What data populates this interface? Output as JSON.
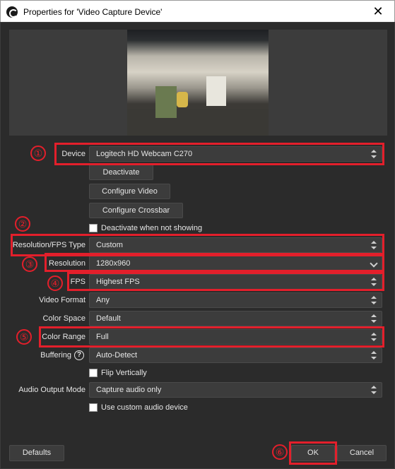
{
  "window": {
    "title": "Properties for 'Video Capture Device'",
    "close_glyph": "✕",
    "app_icon": "obs-icon"
  },
  "form": {
    "device": {
      "label": "Device",
      "value": "Logitech HD Webcam C270"
    },
    "deactivate_label": "Deactivate",
    "configure_video_label": "Configure Video",
    "configure_crossbar_label": "Configure Crossbar",
    "deactivate_when_hidden": {
      "label": "Deactivate when not showing",
      "checked": false
    },
    "res_fps_type": {
      "label": "Resolution/FPS Type",
      "value": "Custom"
    },
    "resolution": {
      "label": "Resolution",
      "value": "1280x960"
    },
    "fps": {
      "label": "FPS",
      "value": "Highest FPS"
    },
    "video_format": {
      "label": "Video Format",
      "value": "Any"
    },
    "color_space": {
      "label": "Color Space",
      "value": "Default"
    },
    "color_range": {
      "label": "Color Range",
      "value": "Full"
    },
    "buffering": {
      "label": "Buffering",
      "value": "Auto-Detect",
      "help_glyph": "?"
    },
    "flip_vertically": {
      "label": "Flip Vertically",
      "checked": false
    },
    "audio_output_mode": {
      "label": "Audio Output Mode",
      "value": "Capture audio only"
    },
    "use_custom_audio": {
      "label": "Use custom audio device",
      "checked": false
    }
  },
  "footer": {
    "defaults_label": "Defaults",
    "ok_label": "OK",
    "cancel_label": "Cancel"
  },
  "annotations": {
    "markers": [
      "①",
      "②",
      "③",
      "④",
      "⑤",
      "⑥"
    ],
    "color": "#e31f2b"
  },
  "colors": {
    "background": "#2b2b2b",
    "field": "#3c3c3c",
    "highlight": "#e31f2b"
  }
}
